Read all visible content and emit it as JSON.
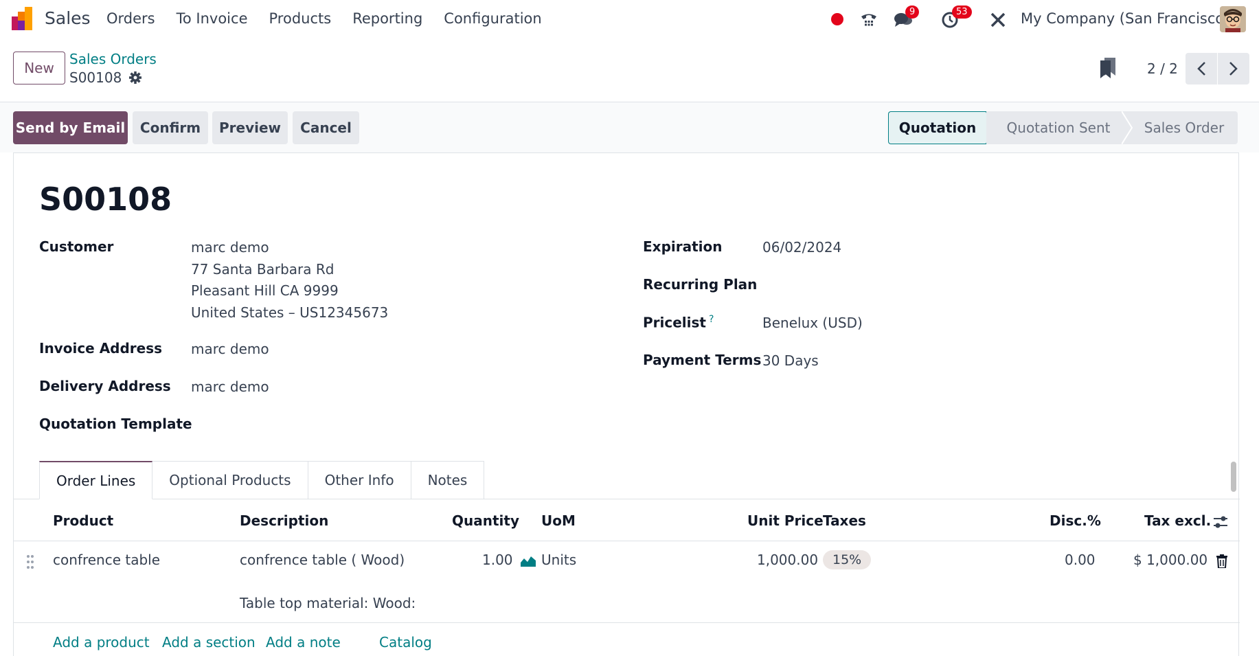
{
  "navbar": {
    "app_name": "Sales",
    "menu": [
      "Orders",
      "To Invoice",
      "Products",
      "Reporting",
      "Configuration"
    ],
    "messages_count": "9",
    "activities_count": "53",
    "company": "My Company (San Francisco)",
    "brand_color": "#714b67",
    "accent_color": "#017e84"
  },
  "control_panel": {
    "new_label": "New",
    "breadcrumb_parent": "Sales Orders",
    "breadcrumb_current": "S00108",
    "pager": "2 / 2"
  },
  "actions": {
    "send_email": "Send by Email",
    "confirm": "Confirm",
    "preview": "Preview",
    "cancel": "Cancel"
  },
  "status": {
    "stages": [
      "Quotation",
      "Quotation Sent",
      "Sales Order"
    ],
    "active": "Quotation"
  },
  "form": {
    "title": "S00108",
    "customer_label": "Customer",
    "customer_name": "marc demo",
    "customer_addr1": "77 Santa Barbara Rd",
    "customer_addr2": "Pleasant Hill CA 9999",
    "customer_addr3": "United States – US12345673",
    "invoice_label": "Invoice Address",
    "invoice_value": "marc demo",
    "delivery_label": "Delivery Address",
    "delivery_value": "marc demo",
    "template_label": "Quotation Template",
    "expiration_label": "Expiration",
    "expiration_value": "06/02/2024",
    "recurring_label": "Recurring Plan",
    "pricelist_label": "Pricelist",
    "pricelist_help": "?",
    "pricelist_value": "Benelux (USD)",
    "payment_label": "Payment Terms",
    "payment_value": "30 Days"
  },
  "tabs": [
    "Order Lines",
    "Optional Products",
    "Other Info",
    "Notes"
  ],
  "table": {
    "headers": {
      "product": "Product",
      "description": "Description",
      "quantity": "Quantity",
      "uom": "UoM",
      "unit_price": "Unit Price",
      "taxes": "Taxes",
      "discount": "Disc.%",
      "tax_excl": "Tax excl."
    },
    "row": {
      "product": "confrence table",
      "description": "confrence table ( Wood)",
      "description_extra": "Table top material:  Wood:",
      "quantity": "1.00",
      "uom": "Units",
      "unit_price": "1,000.00",
      "taxes": "15%",
      "discount": "0.00",
      "subtotal": "$ 1,000.00"
    },
    "links": {
      "add_product": "Add a product",
      "add_section": "Add a section",
      "add_note": "Add a note",
      "catalog": "Catalog"
    }
  }
}
